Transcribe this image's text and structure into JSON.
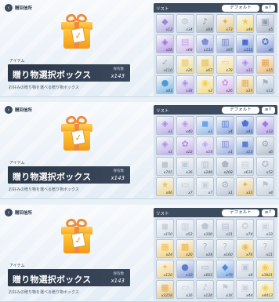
{
  "panels": [
    {
      "location": "贈回信所",
      "item_label": "アイテム",
      "item_name": "贈り物選択ボックス",
      "owned_label": "保有数",
      "owned_count": "x143",
      "description": "お好みの贈り物を選べる贈り物ボックス",
      "list_title": "リスト",
      "sort_label": "デフォルト",
      "filter_label": "≡↑",
      "tiles": [
        {
          "qty": "x12",
          "color": "#9b8ad6",
          "icon": "crystal-icon"
        },
        {
          "qty": "x34",
          "color": "#b7c3d6",
          "icon": "gear-icon"
        },
        {
          "qty": "x64",
          "color": "#8c96a8",
          "icon": "bell-icon"
        },
        {
          "qty": "x73",
          "color": "#e3b34c",
          "icon": "lamp-icon"
        },
        {
          "qty": "x48",
          "color": "#f0c94a",
          "icon": "star-icon"
        },
        {
          "qty": "x5",
          "color": "#8e9bb0",
          "icon": "box-icon"
        },
        {
          "qty": "x26",
          "color": "#9a6ddb",
          "icon": "gem-icon"
        },
        {
          "qty": "x68",
          "color": "#c7a2e8",
          "icon": "ticket-icon"
        },
        {
          "qty": "x133",
          "color": "#7f8fd8",
          "icon": "shield-icon"
        },
        {
          "qty": "x97",
          "color": "#6f86c9",
          "icon": "book-icon"
        },
        {
          "qty": "x133",
          "color": "#4c6fd2",
          "icon": "cube-icon"
        },
        {
          "qty": "x6",
          "color": "#5472c8",
          "icon": "badge-icon"
        },
        {
          "qty": "x110",
          "color": "#9aa8bc",
          "icon": "check-icon"
        },
        {
          "qty": "x26",
          "color": "#eccf6a",
          "icon": "gift-icon"
        },
        {
          "qty": "x67",
          "color": "#e7c457",
          "icon": "gift-icon"
        },
        {
          "qty": "x78",
          "color": "#f3d26b",
          "icon": "card-icon"
        },
        {
          "qty": "x31",
          "color": "#a68fe0",
          "icon": "gem-icon"
        },
        {
          "qty": "x15",
          "color": "#e6a24a",
          "icon": "chest-icon"
        },
        {
          "qty": "x43",
          "color": "#4d9ad6",
          "icon": "orb-icon"
        },
        {
          "qty": "x38",
          "color": "#a890e8",
          "icon": "gem-icon"
        },
        {
          "qty": "x2",
          "color": "#f2cf58",
          "icon": "coin-icon"
        },
        {
          "qty": "x26",
          "color": "#c998e6",
          "icon": "ribbon-icon"
        },
        {
          "qty": "x35",
          "color": "#e5b451",
          "icon": "chest-icon"
        },
        {
          "qty": "x13",
          "color": "#9db1c9",
          "icon": "flag-icon"
        }
      ]
    },
    {
      "location": "贈回信所",
      "item_label": "アイテム",
      "item_name": "贈り物選択ボックス",
      "owned_label": "保有数",
      "owned_count": "x143",
      "description": "お好みの贈り物を選べる贈り物ボックス",
      "list_title": "リスト",
      "sort_label": "デフォルト",
      "filter_label": "≡↑",
      "tiles": [
        {
          "qty": "x1",
          "color": "#a58ce3",
          "icon": "gem-icon"
        },
        {
          "qty": "x40",
          "color": "#b49be6",
          "icon": "gem-icon"
        },
        {
          "qty": "x1",
          "color": "#6fa2e2",
          "icon": "cube-icon"
        },
        {
          "qty": "x4",
          "color": "#5f83d1",
          "icon": "book-icon"
        },
        {
          "qty": "x41",
          "color": "#4e76cf",
          "icon": "shield-icon"
        },
        {
          "qty": "x33",
          "color": "#9d7de0",
          "icon": "crystal-icon"
        },
        {
          "qty": "x1",
          "color": "#a691e0",
          "icon": "gem-icon"
        },
        {
          "qty": "x22",
          "color": "#b38fe3",
          "icon": "ribbon-icon"
        },
        {
          "qty": "x14",
          "color": "#b9a8ea",
          "icon": "gem-icon"
        },
        {
          "qty": "x1",
          "color": "#7f90d8",
          "icon": "book-icon"
        },
        {
          "qty": "x13",
          "color": "#5c7fd0",
          "icon": "cube-icon"
        },
        {
          "qty": "x6",
          "color": "#9aa7ba",
          "icon": "gear-icon"
        },
        {
          "qty": "x795",
          "color": "#bcc7d6",
          "icon": "cube-icon"
        },
        {
          "qty": "x36",
          "color": "#c0cbd9",
          "icon": "box-icon"
        },
        {
          "qty": "x248",
          "color": "#b5c2d3",
          "icon": "book-icon"
        },
        {
          "qty": "x268",
          "color": "#aab8cb",
          "icon": "shield-icon"
        },
        {
          "qty": "x636",
          "color": "#c7d1de",
          "icon": "ticket-icon"
        },
        {
          "qty": "x52",
          "color": "#b0bdcf",
          "icon": "badge-icon"
        },
        {
          "qty": "x46",
          "color": "#e8c662",
          "icon": "star-icon"
        },
        {
          "qty": "x7",
          "color": "#b9c5d6",
          "icon": "card-icon"
        },
        {
          "qty": "x7",
          "color": "#c8d2df",
          "icon": "box-icon"
        },
        {
          "qty": "x1",
          "color": "#a4b3c7",
          "icon": "gear-icon"
        },
        {
          "qty": "x32",
          "color": "#e3b656",
          "icon": "lamp-icon"
        },
        {
          "qty": "x4",
          "color": "#b6c2d3",
          "icon": "flag-icon"
        }
      ]
    },
    {
      "location": "贈回信所",
      "item_label": "アイテム",
      "item_name": "贈り物選択ボックス",
      "owned_label": "保有数",
      "owned_count": "x143",
      "description": "お好みの贈り物を選べる贈り物ボックス",
      "list_title": "リスト",
      "sort_label": "デフォルト",
      "filter_label": "≡↑",
      "tiles": [
        {
          "qty": "x150",
          "color": "#c9d3e0",
          "icon": "cube-icon"
        },
        {
          "qty": "x52",
          "color": "#c2ccdb",
          "icon": "book-icon"
        },
        {
          "qty": "x100",
          "color": "#bcc7d7",
          "icon": "shield-icon"
        },
        {
          "qty": "x31",
          "color": "#b5c1d3",
          "icon": "ticket-icon"
        },
        {
          "qty": "x74",
          "color": "#c4cedc",
          "icon": "badge-icon"
        },
        {
          "qty": "x33",
          "color": "#ccd5e1",
          "icon": "box-icon"
        },
        {
          "qty": "x24",
          "color": "#f0c24e",
          "icon": "chest-icon"
        },
        {
          "qty": "x20",
          "color": "#eeb746",
          "icon": "gift-icon"
        },
        {
          "qty": "x28",
          "color": "#a9b6c9",
          "icon": "question-icon"
        },
        {
          "qty": "x160",
          "color": "#b3bfd0",
          "icon": "question-icon"
        },
        {
          "qty": "x76",
          "color": "#e6c15b",
          "icon": "coin-icon"
        },
        {
          "qty": "x11",
          "color": "#b0bccd",
          "icon": "question-icon"
        },
        {
          "qty": "x120",
          "color": "#f0c65a",
          "icon": "lamp-icon"
        },
        {
          "qty": "x10",
          "color": "#5d7ccc",
          "icon": "orb-icon"
        },
        {
          "qty": "x603",
          "color": "#aab7ca",
          "icon": "card-icon"
        },
        {
          "qty": "x79",
          "color": "#4d8ad9",
          "icon": "crystal-icon"
        },
        {
          "qty": "x8",
          "color": "#bdc8d7",
          "icon": "box-icon"
        },
        {
          "qty": "x3821",
          "color": "#f2cb52",
          "icon": "coin-icon"
        },
        {
          "qty": "x3258",
          "color": "#e5b04b",
          "icon": "chest-icon"
        },
        {
          "qty": "x16",
          "color": "#c3cedc",
          "icon": "card-icon"
        },
        {
          "qty": "x12K",
          "color": "#b4c0d1",
          "icon": "bell-icon"
        },
        {
          "qty": "x1K",
          "color": "#bfcad9",
          "icon": "flag-icon"
        },
        {
          "qty": "x44",
          "color": "#c9d3df",
          "icon": "box-icon"
        },
        {
          "qty": "x4413",
          "color": "#f1d266",
          "icon": "coin-icon"
        }
      ]
    }
  ]
}
